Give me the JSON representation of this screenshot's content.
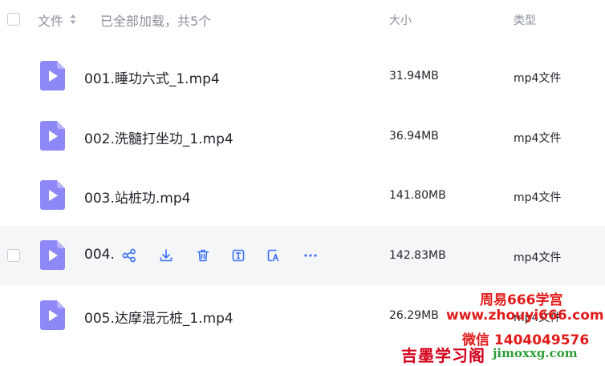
{
  "header": {
    "name_label": "文件",
    "status_text": "已全部加载，共5个",
    "size_label": "大小",
    "type_label": "类型"
  },
  "files": [
    {
      "name": "001.睡功六式_1.mp4",
      "size": "31.94MB",
      "type": "mp4文件"
    },
    {
      "name": "002.洗髓打坐功_1.mp4",
      "size": "36.94MB",
      "type": "mp4文件"
    },
    {
      "name": "003.站桩功.mp4",
      "size": "141.80MB",
      "type": "mp4文件"
    },
    {
      "name": "004.",
      "size": "142.83MB",
      "type": "mp4文件"
    },
    {
      "name": "005.达摩混元桩_1.mp4",
      "size": "26.29MB",
      "type": "mp4文件"
    }
  ],
  "hover_actions": [
    "share-icon",
    "download-icon",
    "delete-icon",
    "rename-icon",
    "copy-icon",
    "more-icon"
  ],
  "watermark": {
    "line1": "周易666学宫",
    "line2": "www.zhouyi666.com",
    "line3": "微信 1404049576",
    "brand": "吉墨学习阁",
    "brand_url": "jimoxxg.com"
  },
  "colors": {
    "icon_bg": "#8e88f7",
    "accent": "#3b6ff5",
    "hover_row": "#f5f6f8",
    "watermark_red": "#e11b1b"
  }
}
